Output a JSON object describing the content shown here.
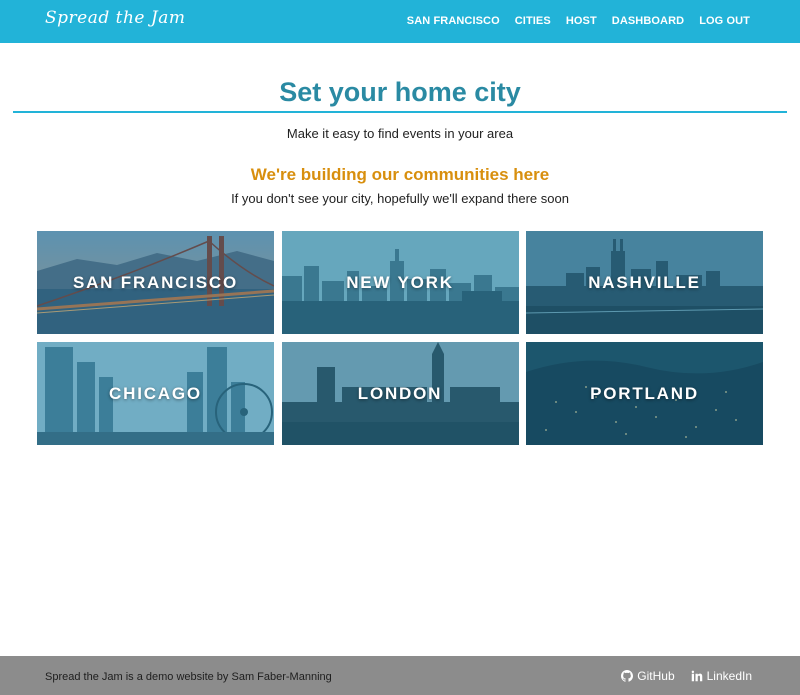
{
  "brand": "Spread the Jam",
  "nav": [
    {
      "label": "SAN FRANCISCO"
    },
    {
      "label": "CITIES"
    },
    {
      "label": "HOST"
    },
    {
      "label": "DASHBOARD"
    },
    {
      "label": "LOG OUT"
    }
  ],
  "header": {
    "title": "Set your home city",
    "subtitle": "Make it easy to find events in your area"
  },
  "section": {
    "heading": "We're building our communities here",
    "subtext": "If you don't see your city, hopefully we'll expand there soon"
  },
  "cities": [
    {
      "name": "SAN FRANCISCO",
      "icon": "golden-gate-bridge-photo"
    },
    {
      "name": "NEW YORK",
      "icon": "new-york-skyline-photo"
    },
    {
      "name": "NASHVILLE",
      "icon": "nashville-skyline-photo"
    },
    {
      "name": "CHICAGO",
      "icon": "chicago-skyline-photo"
    },
    {
      "name": "LONDON",
      "icon": "london-parliament-photo"
    },
    {
      "name": "PORTLAND",
      "icon": "portland-night-photo"
    }
  ],
  "footer": {
    "text": "Spread the Jam is a demo website by Sam Faber-Manning",
    "github": "GitHub",
    "linkedin": "LinkedIn"
  },
  "colors": {
    "navbar": "#22b3d8",
    "title": "#2a8aa3",
    "section_heading": "#d88f0e",
    "footer": "#8c8c8c"
  }
}
